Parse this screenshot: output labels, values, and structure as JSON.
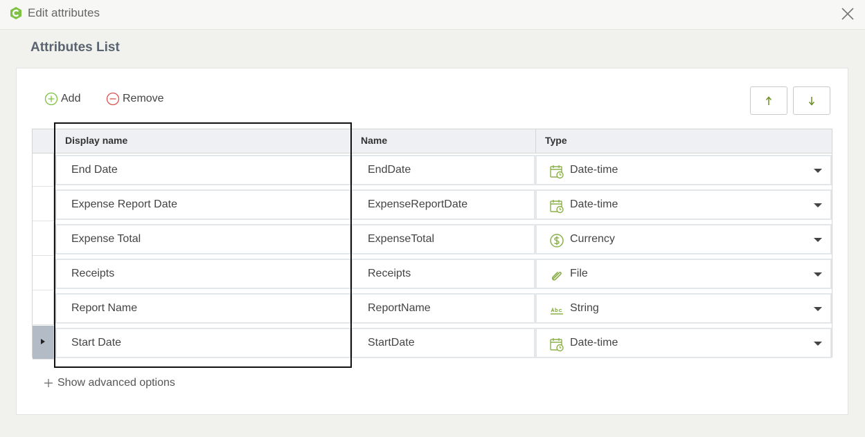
{
  "window": {
    "title": "Edit attributes"
  },
  "section": {
    "title": "Attributes List"
  },
  "toolbar": {
    "add_label": "Add",
    "remove_label": "Remove",
    "move_up_icon": "arrow-up-icon",
    "move_down_icon": "arrow-down-icon"
  },
  "grid": {
    "columns": [
      "Display name",
      "Name",
      "Type"
    ],
    "rows": [
      {
        "display_name": "End Date",
        "name": "EndDate",
        "type": "Date-time",
        "type_icon": "calendar-clock-icon"
      },
      {
        "display_name": "Expense Report Date",
        "name": "ExpenseReportDate",
        "type": "Date-time",
        "type_icon": "calendar-clock-icon"
      },
      {
        "display_name": "Expense Total",
        "name": "ExpenseTotal",
        "type": "Currency",
        "type_icon": "currency-icon"
      },
      {
        "display_name": "Receipts",
        "name": "Receipts",
        "type": "File",
        "type_icon": "paperclip-icon"
      },
      {
        "display_name": "Report Name",
        "name": "ReportName",
        "type": "String",
        "type_icon": "abc-string-icon"
      },
      {
        "display_name": "Start Date",
        "name": "StartDate",
        "type": "Date-time",
        "type_icon": "calendar-clock-icon"
      }
    ],
    "current_row": 5
  },
  "advanced": {
    "label": "Show advanced options"
  },
  "colors": {
    "accent_green": "#7dc242",
    "remove_red": "#d9534f",
    "calendar_green": "#8ab04a",
    "header_bg": "#eef0f3",
    "current_row_header": "#b3bcc6"
  }
}
